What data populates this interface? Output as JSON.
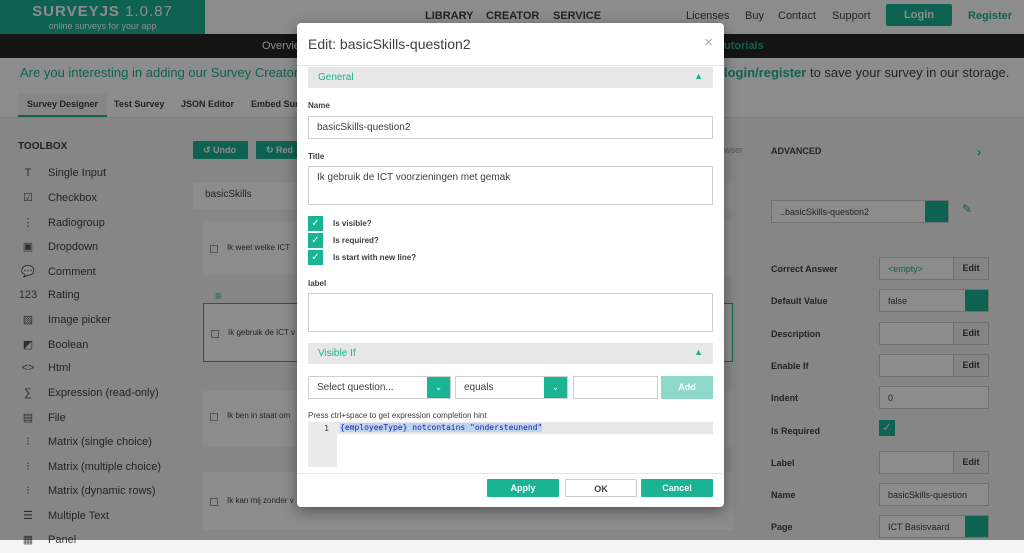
{
  "header": {
    "logo_title": "SURVEYJS",
    "logo_version": "1.0.87",
    "logo_subtitle": "online surveys for your app",
    "nav": [
      "LIBRARY",
      "CREATOR",
      "SERVICE"
    ],
    "links": [
      "Licenses",
      "Buy",
      "Contact",
      "Support"
    ],
    "login_label": "Login",
    "register_label": "Register",
    "overview_label": "Overvie",
    "tutorials_label": "utorials"
  },
  "banner": {
    "left_text": "Are you interesting in adding our Survey Creator",
    "right_link": "login/register",
    "right_text": " to save your survey in our storage."
  },
  "tabs": [
    "Survey Designer",
    "Test Survey",
    "JSON Editor",
    "Embed Sur"
  ],
  "toolbox": {
    "title": "TOOLBOX",
    "items": [
      {
        "icon": "T",
        "label": "Single Input"
      },
      {
        "icon": "☑",
        "label": "Checkbox"
      },
      {
        "icon": "⋮",
        "label": "Radiogroup"
      },
      {
        "icon": "▣",
        "label": "Dropdown"
      },
      {
        "icon": "💬",
        "label": "Comment"
      },
      {
        "icon": "123",
        "label": "Rating"
      },
      {
        "icon": "▨",
        "label": "Image picker"
      },
      {
        "icon": "◩",
        "label": "Boolean"
      },
      {
        "icon": "<>",
        "label": "Html"
      },
      {
        "icon": "∑",
        "label": "Expression (read-only)"
      },
      {
        "icon": "▤",
        "label": "File"
      },
      {
        "icon": "⁝",
        "label": "Matrix (single choice)"
      },
      {
        "icon": "⁝",
        "label": "Matrix (multiple choice)"
      },
      {
        "icon": "⁝",
        "label": "Matrix (dynamic rows)"
      },
      {
        "icon": "☰",
        "label": "Multiple Text"
      },
      {
        "icon": "▦",
        "label": "Panel"
      }
    ]
  },
  "editor": {
    "undo_label": "Undo",
    "redo_label": "Red",
    "survey_title": "basicSkills",
    "questions": [
      "Ik weet welke ICT",
      "Ik gebruik de ICT v",
      "Ik ben in staat om",
      "Ik kan mij zonder v"
    ]
  },
  "right_panel": {
    "advanced_label": "ADVANCED",
    "browser_label": "wser",
    "selected_object": "..basicSkills-question2",
    "properties": [
      {
        "label": "Correct Answer",
        "value": "<empty>",
        "control": "edit"
      },
      {
        "label": "Default Value",
        "value": "false",
        "control": "dropdown"
      },
      {
        "label": "Description",
        "value": "",
        "control": "edit"
      },
      {
        "label": "Enable If",
        "value": "",
        "control": "edit"
      },
      {
        "label": "Indent",
        "value": "0",
        "control": "text"
      },
      {
        "label": "Is Required",
        "value": "",
        "control": "check"
      },
      {
        "label": "Label",
        "value": "",
        "control": "edit"
      },
      {
        "label": "Name",
        "value": "basicSkills-question",
        "control": "text"
      },
      {
        "label": "Page",
        "value": "ICT Basisvaard",
        "control": "dropdown"
      }
    ],
    "edit_label": "Edit"
  },
  "modal": {
    "title": "Edit: basicSkills-question2",
    "general_label": "General",
    "name_label": "Name",
    "name_value": "basicSkills-question2",
    "title_label": "Title",
    "title_value": "Ik gebruik de ICT voorzieningen met gemak",
    "checks": [
      "Is visible?",
      "Is required?",
      "Is start with new line?"
    ],
    "label_label": "label",
    "label_value": "",
    "visible_if_label": "Visible If",
    "select_question": "Select question...",
    "operator": "equals",
    "value_input": "",
    "add_label": "Add",
    "hint": "Press ctrl+space to get expression completion hint",
    "code_line_number": "1",
    "code_text": "{employeeType} notcontains \"ondersteunend\"",
    "apply_label": "Apply",
    "ok_label": "OK",
    "cancel_label": "Cancel"
  },
  "colors": {
    "accent": "#1ab394",
    "dark": "#262626"
  }
}
